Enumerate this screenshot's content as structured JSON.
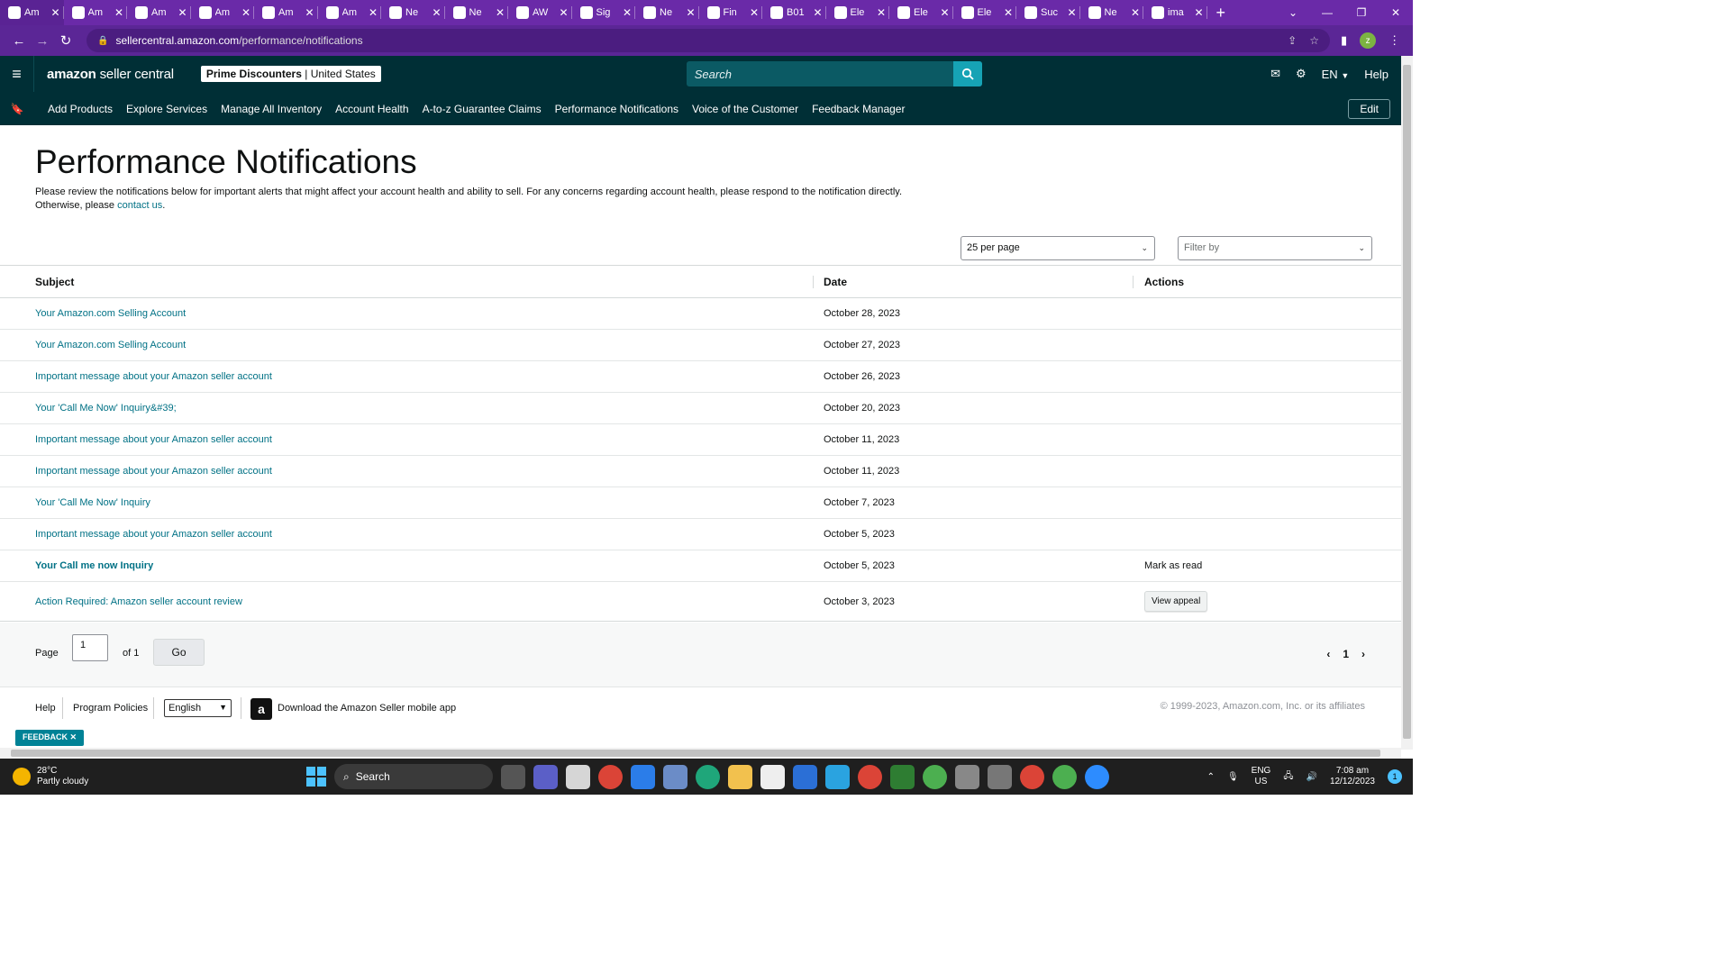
{
  "browser": {
    "tabs": [
      {
        "label": "Am",
        "icon": "amazon-icon",
        "active": true
      },
      {
        "label": "Am",
        "icon": "amazon-icon"
      },
      {
        "label": "Am",
        "icon": "amazon-icon"
      },
      {
        "label": "Am",
        "icon": "amazon-icon"
      },
      {
        "label": "Am",
        "icon": "amazon-icon"
      },
      {
        "label": "Am",
        "icon": "amazon-icon"
      },
      {
        "label": "Ne",
        "icon": "chatgpt-icon"
      },
      {
        "label": "Ne",
        "icon": "chatgpt-icon"
      },
      {
        "label": "AW",
        "icon": "globe-icon"
      },
      {
        "label": "Sig",
        "icon": "w-icon"
      },
      {
        "label": "Ne",
        "icon": "chatgpt-icon"
      },
      {
        "label": "Fin",
        "icon": "sheets-icon"
      },
      {
        "label": "B01",
        "icon": "google-icon"
      },
      {
        "label": "Ele",
        "icon": "gmail-icon"
      },
      {
        "label": "Ele",
        "icon": "gmail-icon"
      },
      {
        "label": "Ele",
        "icon": "gmail-icon"
      },
      {
        "label": "Suc",
        "icon": "gmail-icon"
      },
      {
        "label": "Ne",
        "icon": "chatgpt-icon"
      },
      {
        "label": "ima",
        "icon": "image-icon"
      }
    ],
    "url_host": "sellercentral.amazon.com",
    "url_path": "/performance/notifications",
    "profile_initial": "z"
  },
  "header": {
    "logo_bold": "amazon",
    "logo_light": " seller central",
    "account_name": "Prime Discounters",
    "account_sep": " | ",
    "account_region": "United States",
    "search_placeholder": "Search",
    "language": "EN",
    "help": "Help"
  },
  "nav": {
    "links": [
      "Add Products",
      "Explore Services",
      "Manage All Inventory",
      "Account Health",
      "A-to-z Guarantee Claims",
      "Performance Notifications",
      "Voice of the Customer",
      "Feedback Manager"
    ],
    "edit": "Edit"
  },
  "page": {
    "title": "Performance Notifications",
    "description": "Please review the notifications below for important alerts that might affect your account health and ability to sell. For any concerns regarding account health, please respond to the notification directly. Otherwise, please ",
    "contact_link": "contact us",
    "description_end": ".",
    "per_page": "25 per page",
    "filter_placeholder": "Filter by"
  },
  "table": {
    "headers": {
      "subject": "Subject",
      "date": "Date",
      "actions": "Actions"
    },
    "rows": [
      {
        "subject": "Your Amazon.com Selling Account",
        "date": "October 28, 2023",
        "action": ""
      },
      {
        "subject": "Your Amazon.com Selling Account",
        "date": "October 27, 2023",
        "action": ""
      },
      {
        "subject": "Important message about your Amazon seller account",
        "date": "October 26, 2023",
        "action": ""
      },
      {
        "subject": "Your 'Call Me Now' Inquiry&#39;",
        "date": "October 20, 2023",
        "action": ""
      },
      {
        "subject": "Important message about your Amazon seller account",
        "date": "October 11, 2023",
        "action": ""
      },
      {
        "subject": "Important message about your Amazon seller account",
        "date": "October 11, 2023",
        "action": ""
      },
      {
        "subject": "Your 'Call Me Now' Inquiry",
        "date": "October 7, 2023",
        "action": ""
      },
      {
        "subject": "Important message about your Amazon seller account",
        "date": "October 5, 2023",
        "action": ""
      },
      {
        "subject": "Your Call me now Inquiry",
        "date": "October 5, 2023",
        "action": "Mark as read",
        "unread": true
      },
      {
        "subject": "Action Required: Amazon seller account review",
        "date": "October 3, 2023",
        "action": "View appeal",
        "action_button": true
      }
    ]
  },
  "pagination": {
    "page_label": "Page",
    "page_value": "1",
    "of_label": "of 1",
    "go": "Go",
    "current": "1"
  },
  "footer": {
    "help": "Help",
    "policies": "Program Policies",
    "language": "English",
    "app_text": "Download the Amazon Seller mobile app",
    "copyright": "© 1999-2023, Amazon.com, Inc. or its affiliates"
  },
  "feedback_label": "FEEDBACK",
  "taskbar": {
    "temp": "28°C",
    "weather": "Partly cloudy",
    "search": "Search",
    "lang1": "ENG",
    "lang2": "US",
    "time": "7:08 am",
    "date": "12/12/2023",
    "notif_count": "1"
  },
  "colors": {
    "chrome_purple": "#6a2aa8",
    "header_bg": "#002f36",
    "link": "#007185",
    "search_btn": "#16a3b5"
  }
}
